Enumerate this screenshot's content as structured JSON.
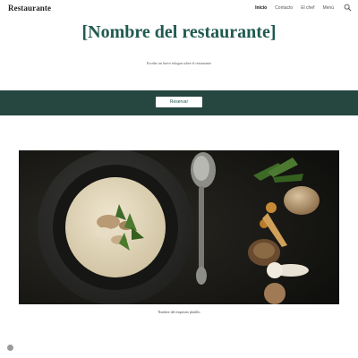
{
  "header": {
    "brand": "Restaurante",
    "nav": [
      {
        "label": "Inicio",
        "active": true
      },
      {
        "label": "Contacto",
        "active": false
      },
      {
        "label": "El chef",
        "active": false
      },
      {
        "label": "Menú",
        "active": false
      }
    ],
    "search_icon": "search-icon"
  },
  "hero": {
    "title": "[Nombre del restaurante]",
    "subtitle": "Escribe un breve eslogan sobre el restaurante"
  },
  "band": {
    "button_label": "Reservar",
    "background": "#264640"
  },
  "main": {
    "caption": "Nombre del exquisito platillo"
  },
  "colors": {
    "accent": "#1f5a4f",
    "band": "#264640"
  }
}
